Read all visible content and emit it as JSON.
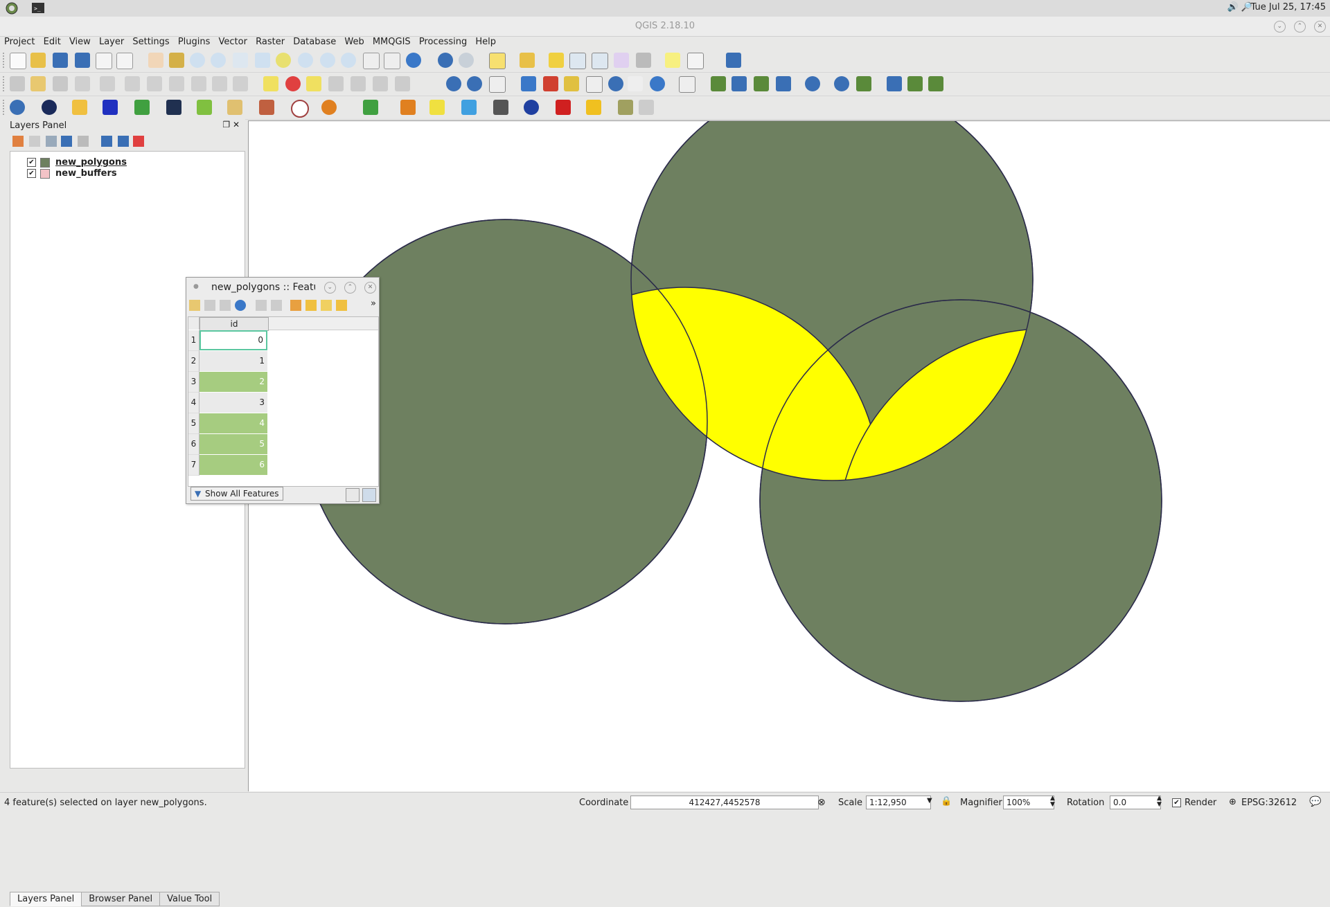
{
  "system": {
    "clock": "Tue Jul 25, 17:45"
  },
  "window": {
    "title": "QGIS 2.18.10"
  },
  "menu": [
    "Project",
    "Edit",
    "View",
    "Layer",
    "Settings",
    "Plugins",
    "Vector",
    "Raster",
    "Database",
    "Web",
    "MMQGIS",
    "Processing",
    "Help"
  ],
  "layers_panel": {
    "title": "Layers Panel",
    "layers": [
      {
        "name": "new_polygons",
        "checked": true,
        "swatch": "#6e8060"
      },
      {
        "name": "new_buffers",
        "checked": true,
        "swatch": "#f3c3c7"
      }
    ],
    "tabs": [
      "Layers Panel",
      "Browser Panel",
      "Value Tool"
    ]
  },
  "attribute_table": {
    "title": "new_polygons :: Features",
    "column": "id",
    "rows": [
      {
        "num": "1",
        "id": "0",
        "state": "current"
      },
      {
        "num": "2",
        "id": "1",
        "state": "unselected"
      },
      {
        "num": "3",
        "id": "2",
        "state": "selected"
      },
      {
        "num": "4",
        "id": "3",
        "state": "unselected"
      },
      {
        "num": "5",
        "id": "4",
        "state": "selected"
      },
      {
        "num": "6",
        "id": "5",
        "state": "selected"
      },
      {
        "num": "7",
        "id": "6",
        "state": "selected"
      }
    ],
    "filter_label": "Show All Features"
  },
  "map": {
    "polygon_color": "#6e8060",
    "selection_color": "#ffff00",
    "outline_color": "#2b2b4a"
  },
  "status": {
    "message": "4 feature(s) selected on layer new_polygons.",
    "coordinate_label": "Coordinate",
    "coordinate_value": "412427,4452578",
    "scale_label": "Scale",
    "scale_value": "1:12,950",
    "magnifier_label": "Magnifier",
    "magnifier_value": "100%",
    "rotation_label": "Rotation",
    "rotation_value": "0.0",
    "render_label": "Render",
    "crs": "EPSG:32612"
  }
}
